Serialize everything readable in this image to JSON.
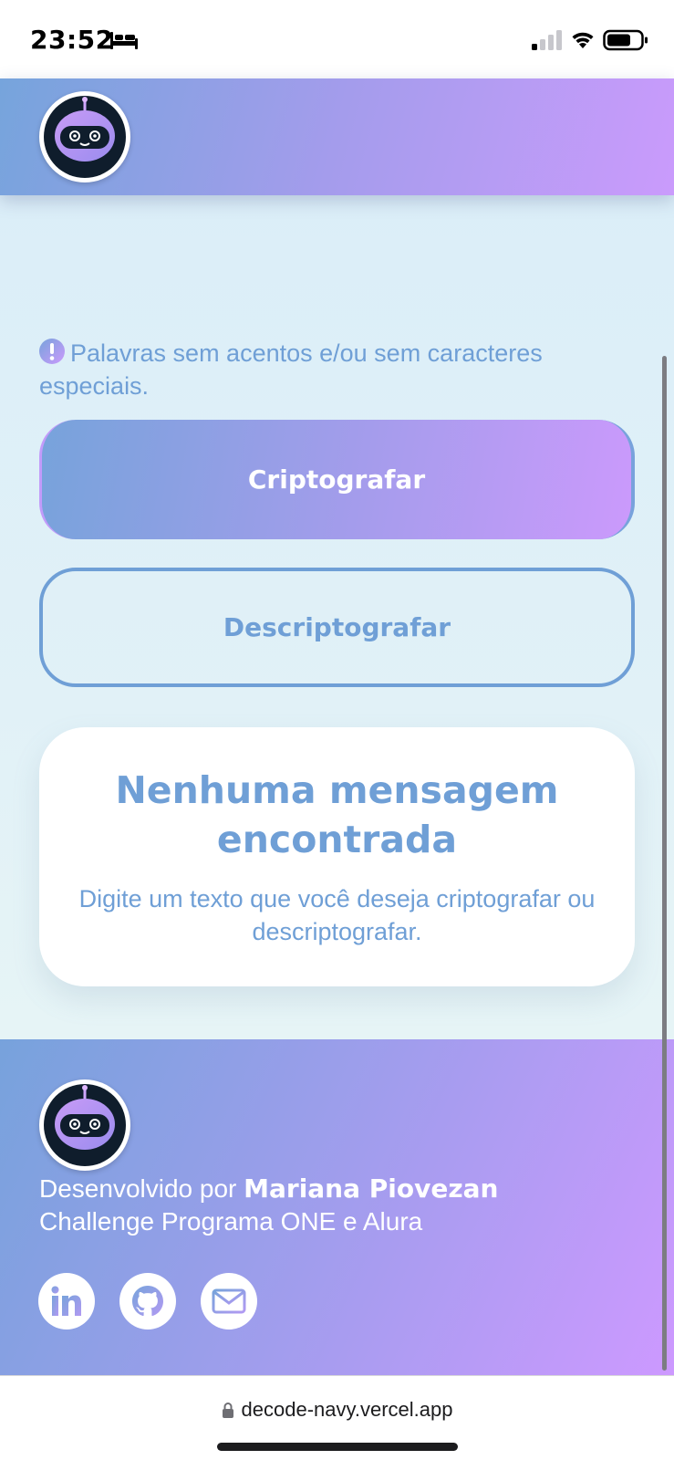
{
  "status_bar": {
    "time": "23:52",
    "icons": [
      "bed-icon",
      "signal-icon",
      "wifi-icon",
      "battery-icon"
    ]
  },
  "header": {
    "logo": "robot-avatar"
  },
  "notice": {
    "icon": "exclamation-circle-icon",
    "text": "Palavras sem acentos e/ou sem caracteres especiais."
  },
  "buttons": {
    "encrypt": "Criptografar",
    "decrypt": "Descriptografar"
  },
  "message_card": {
    "title": "Nenhuma mensagem encontrada",
    "text": "Digite um texto que você deseja criptografar ou descriptografar."
  },
  "footer": {
    "developed_by": "Desenvolvido por ",
    "author": "Mariana Piovezan",
    "challenge": "Challenge Programa ONE e Alura",
    "social": [
      "linkedin-icon",
      "github-icon",
      "email-icon"
    ]
  },
  "browser": {
    "url": "decode-navy.vercel.app"
  },
  "colors": {
    "accent": "#6f9fd6",
    "gradient_start": "#77a3db",
    "gradient_end": "#cb9afc",
    "background": "#dbeef8"
  }
}
